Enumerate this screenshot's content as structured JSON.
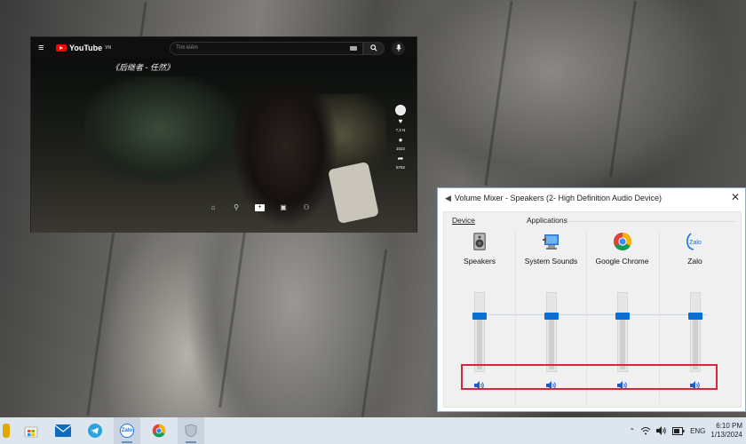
{
  "youtube": {
    "logo_text": "YouTube",
    "logo_sup": "VN",
    "search_placeholder": "Tìm kiếm",
    "caption": "《后继者 - 任然》",
    "likes": "7,2 N",
    "comments": "1022",
    "shares": "5752"
  },
  "mixer": {
    "title": "Volume Mixer - Speakers (2- High Definition Audio Device)",
    "device_header": "Device",
    "apps_header": "Applications",
    "columns": [
      {
        "name": "Speakers",
        "level": 0.72
      },
      {
        "name": "System Sounds",
        "level": 0.72
      },
      {
        "name": "Google Chrome",
        "level": 0.72
      },
      {
        "name": "Zalo",
        "level": 0.72
      }
    ],
    "zalo_icon_text": "Zalo"
  },
  "taskbar": {
    "zalo_label": "Zalo",
    "language": "ENG",
    "time": "6:10 PM",
    "date": "1/13/2024"
  },
  "colors": {
    "mute_highlight": "#d6283a",
    "slider_thumb": "#0a6fd4",
    "taskbar_bg": "#dde6ef"
  }
}
